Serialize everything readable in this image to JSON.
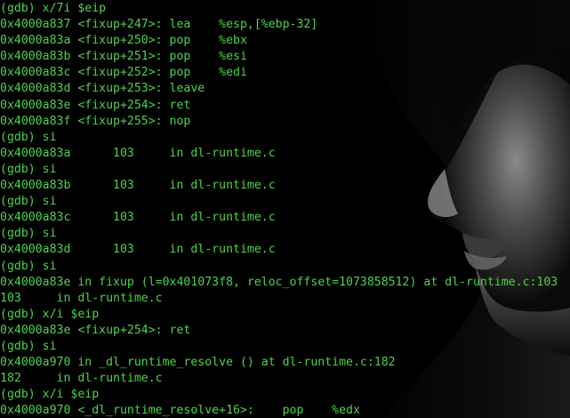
{
  "terminal": {
    "colors": {
      "background": "#000000",
      "text": "#4fd14f"
    },
    "background_art": "hooded-face-icon",
    "lines": [
      "(gdb) x/7i $eip",
      "0x4000a837 <fixup+247>: lea    %esp,[%ebp-32]",
      "0x4000a83a <fixup+250>: pop    %ebx",
      "0x4000a83b <fixup+251>: pop    %esi",
      "0x4000a83c <fixup+252>: pop    %edi",
      "0x4000a83d <fixup+253>: leave",
      "0x4000a83e <fixup+254>: ret",
      "0x4000a83f <fixup+255>: nop",
      "(gdb) si",
      "0x4000a83a      103     in dl-runtime.c",
      "(gdb) si",
      "0x4000a83b      103     in dl-runtime.c",
      "(gdb) si",
      "0x4000a83c      103     in dl-runtime.c",
      "(gdb) si",
      "0x4000a83d      103     in dl-runtime.c",
      "(gdb) si",
      "0x4000a83e in fixup (l=0x401073f8, reloc_offset=1073858512) at dl-runtime.c:103",
      "103     in dl-runtime.c",
      "(gdb) x/i $eip",
      "0x4000a83e <fixup+254>: ret",
      "(gdb) si",
      "0x4000a970 in _dl_runtime_resolve () at dl-runtime.c:182",
      "182     in dl-runtime.c",
      "(gdb) x/i $eip",
      "0x4000a970 <_dl_runtime_resolve+16>:    pop    %edx"
    ]
  }
}
